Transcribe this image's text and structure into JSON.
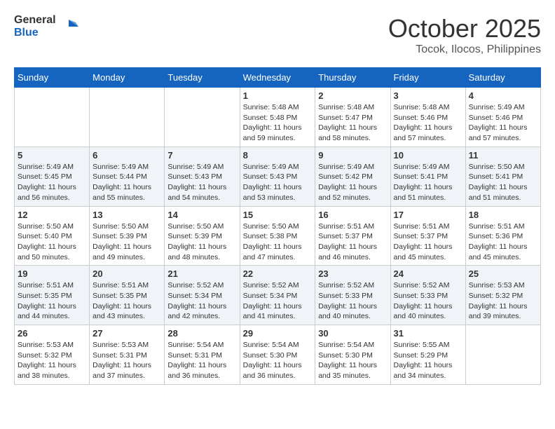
{
  "header": {
    "logo_line1": "General",
    "logo_line2": "Blue",
    "month": "October 2025",
    "location": "Tocok, Ilocos, Philippines"
  },
  "weekdays": [
    "Sunday",
    "Monday",
    "Tuesday",
    "Wednesday",
    "Thursday",
    "Friday",
    "Saturday"
  ],
  "weeks": [
    [
      {
        "day": "",
        "sunrise": "",
        "sunset": "",
        "daylight": ""
      },
      {
        "day": "",
        "sunrise": "",
        "sunset": "",
        "daylight": ""
      },
      {
        "day": "",
        "sunrise": "",
        "sunset": "",
        "daylight": ""
      },
      {
        "day": "1",
        "sunrise": "Sunrise: 5:48 AM",
        "sunset": "Sunset: 5:48 PM",
        "daylight": "Daylight: 11 hours and 59 minutes."
      },
      {
        "day": "2",
        "sunrise": "Sunrise: 5:48 AM",
        "sunset": "Sunset: 5:47 PM",
        "daylight": "Daylight: 11 hours and 58 minutes."
      },
      {
        "day": "3",
        "sunrise": "Sunrise: 5:48 AM",
        "sunset": "Sunset: 5:46 PM",
        "daylight": "Daylight: 11 hours and 57 minutes."
      },
      {
        "day": "4",
        "sunrise": "Sunrise: 5:49 AM",
        "sunset": "Sunset: 5:46 PM",
        "daylight": "Daylight: 11 hours and 57 minutes."
      }
    ],
    [
      {
        "day": "5",
        "sunrise": "Sunrise: 5:49 AM",
        "sunset": "Sunset: 5:45 PM",
        "daylight": "Daylight: 11 hours and 56 minutes."
      },
      {
        "day": "6",
        "sunrise": "Sunrise: 5:49 AM",
        "sunset": "Sunset: 5:44 PM",
        "daylight": "Daylight: 11 hours and 55 minutes."
      },
      {
        "day": "7",
        "sunrise": "Sunrise: 5:49 AM",
        "sunset": "Sunset: 5:43 PM",
        "daylight": "Daylight: 11 hours and 54 minutes."
      },
      {
        "day": "8",
        "sunrise": "Sunrise: 5:49 AM",
        "sunset": "Sunset: 5:43 PM",
        "daylight": "Daylight: 11 hours and 53 minutes."
      },
      {
        "day": "9",
        "sunrise": "Sunrise: 5:49 AM",
        "sunset": "Sunset: 5:42 PM",
        "daylight": "Daylight: 11 hours and 52 minutes."
      },
      {
        "day": "10",
        "sunrise": "Sunrise: 5:49 AM",
        "sunset": "Sunset: 5:41 PM",
        "daylight": "Daylight: 11 hours and 51 minutes."
      },
      {
        "day": "11",
        "sunrise": "Sunrise: 5:50 AM",
        "sunset": "Sunset: 5:41 PM",
        "daylight": "Daylight: 11 hours and 51 minutes."
      }
    ],
    [
      {
        "day": "12",
        "sunrise": "Sunrise: 5:50 AM",
        "sunset": "Sunset: 5:40 PM",
        "daylight": "Daylight: 11 hours and 50 minutes."
      },
      {
        "day": "13",
        "sunrise": "Sunrise: 5:50 AM",
        "sunset": "Sunset: 5:39 PM",
        "daylight": "Daylight: 11 hours and 49 minutes."
      },
      {
        "day": "14",
        "sunrise": "Sunrise: 5:50 AM",
        "sunset": "Sunset: 5:39 PM",
        "daylight": "Daylight: 11 hours and 48 minutes."
      },
      {
        "day": "15",
        "sunrise": "Sunrise: 5:50 AM",
        "sunset": "Sunset: 5:38 PM",
        "daylight": "Daylight: 11 hours and 47 minutes."
      },
      {
        "day": "16",
        "sunrise": "Sunrise: 5:51 AM",
        "sunset": "Sunset: 5:37 PM",
        "daylight": "Daylight: 11 hours and 46 minutes."
      },
      {
        "day": "17",
        "sunrise": "Sunrise: 5:51 AM",
        "sunset": "Sunset: 5:37 PM",
        "daylight": "Daylight: 11 hours and 45 minutes."
      },
      {
        "day": "18",
        "sunrise": "Sunrise: 5:51 AM",
        "sunset": "Sunset: 5:36 PM",
        "daylight": "Daylight: 11 hours and 45 minutes."
      }
    ],
    [
      {
        "day": "19",
        "sunrise": "Sunrise: 5:51 AM",
        "sunset": "Sunset: 5:35 PM",
        "daylight": "Daylight: 11 hours and 44 minutes."
      },
      {
        "day": "20",
        "sunrise": "Sunrise: 5:51 AM",
        "sunset": "Sunset: 5:35 PM",
        "daylight": "Daylight: 11 hours and 43 minutes."
      },
      {
        "day": "21",
        "sunrise": "Sunrise: 5:52 AM",
        "sunset": "Sunset: 5:34 PM",
        "daylight": "Daylight: 11 hours and 42 minutes."
      },
      {
        "day": "22",
        "sunrise": "Sunrise: 5:52 AM",
        "sunset": "Sunset: 5:34 PM",
        "daylight": "Daylight: 11 hours and 41 minutes."
      },
      {
        "day": "23",
        "sunrise": "Sunrise: 5:52 AM",
        "sunset": "Sunset: 5:33 PM",
        "daylight": "Daylight: 11 hours and 40 minutes."
      },
      {
        "day": "24",
        "sunrise": "Sunrise: 5:52 AM",
        "sunset": "Sunset: 5:33 PM",
        "daylight": "Daylight: 11 hours and 40 minutes."
      },
      {
        "day": "25",
        "sunrise": "Sunrise: 5:53 AM",
        "sunset": "Sunset: 5:32 PM",
        "daylight": "Daylight: 11 hours and 39 minutes."
      }
    ],
    [
      {
        "day": "26",
        "sunrise": "Sunrise: 5:53 AM",
        "sunset": "Sunset: 5:32 PM",
        "daylight": "Daylight: 11 hours and 38 minutes."
      },
      {
        "day": "27",
        "sunrise": "Sunrise: 5:53 AM",
        "sunset": "Sunset: 5:31 PM",
        "daylight": "Daylight: 11 hours and 37 minutes."
      },
      {
        "day": "28",
        "sunrise": "Sunrise: 5:54 AM",
        "sunset": "Sunset: 5:31 PM",
        "daylight": "Daylight: 11 hours and 36 minutes."
      },
      {
        "day": "29",
        "sunrise": "Sunrise: 5:54 AM",
        "sunset": "Sunset: 5:30 PM",
        "daylight": "Daylight: 11 hours and 36 minutes."
      },
      {
        "day": "30",
        "sunrise": "Sunrise: 5:54 AM",
        "sunset": "Sunset: 5:30 PM",
        "daylight": "Daylight: 11 hours and 35 minutes."
      },
      {
        "day": "31",
        "sunrise": "Sunrise: 5:55 AM",
        "sunset": "Sunset: 5:29 PM",
        "daylight": "Daylight: 11 hours and 34 minutes."
      },
      {
        "day": "",
        "sunrise": "",
        "sunset": "",
        "daylight": ""
      }
    ]
  ]
}
